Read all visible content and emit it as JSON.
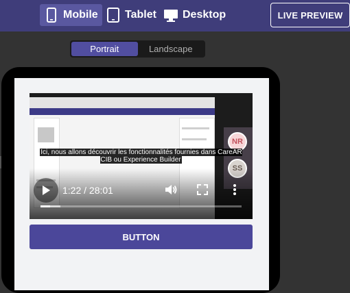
{
  "toolbar": {
    "devices": [
      {
        "label": "Mobile",
        "icon": "mobile-icon",
        "active": true
      },
      {
        "label": "Tablet",
        "icon": "tablet-icon",
        "active": false
      },
      {
        "label": "Desktop",
        "icon": "desktop-icon",
        "active": false
      }
    ],
    "live_preview_label": "LIVE PREVIEW"
  },
  "orientation": {
    "options": [
      "Portrait",
      "Landscape"
    ],
    "selected": "Portrait"
  },
  "video": {
    "caption": "Ici, nous allons découvrir les fonctionnalités fournies dans CareAR CIB ou Experience Builder",
    "time_display": "1:22 / 28:01",
    "progress_fraction": 0.049,
    "buffered_fraction": 0.1,
    "participants": [
      "NR",
      "SS"
    ]
  },
  "content": {
    "button_label": "BUTTON"
  },
  "colors": {
    "toolbar_bg": "#3f3d7a",
    "accent": "#4b479a",
    "canvas_bg": "#333333"
  }
}
